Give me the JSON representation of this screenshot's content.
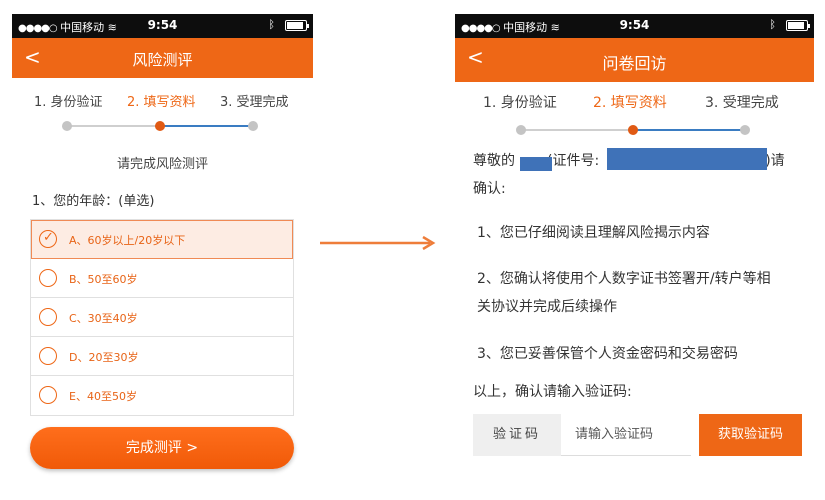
{
  "status_bar": {
    "signal_dots": "●●●●○",
    "carrier": "中国移动",
    "wifi_icon": "wifi-icon",
    "time": "9:54",
    "bluetooth_icon": "bluetooth-icon",
    "battery_icon": "battery-icon"
  },
  "left": {
    "nav": {
      "back": "<",
      "title": "风险测评"
    },
    "steps": [
      "1. 身份验证",
      "2. 填写资料",
      "3. 受理完成"
    ],
    "active_step": 2,
    "prompt": "请完成风险测评",
    "question": "1、您的年龄：(单选)",
    "options": [
      {
        "text": "A、60岁以上/20岁以下",
        "selected": true
      },
      {
        "text": "B、50至60岁",
        "selected": false
      },
      {
        "text": "C、30至40岁",
        "selected": false
      },
      {
        "text": "D、20至30岁",
        "selected": false
      },
      {
        "text": "E、40至50岁",
        "selected": false
      }
    ],
    "finish_button": "完成测评 >"
  },
  "right": {
    "nav": {
      "back": "<",
      "title": "问卷回访"
    },
    "steps": [
      "1. 身份验证",
      "2. 填写资料",
      "3. 受理完成"
    ],
    "active_step": 2,
    "greeting_prefix": "尊敬的",
    "greeting_mid": "(证件号:",
    "greeting_suffix": ")请",
    "greeting_line2": "确认:",
    "item1": "1、您已仔细阅读且理解风险揭示内容",
    "item2_line1": "2、您确认将使用个人数字证书签署开/转户等相",
    "item2_line2": "关协议并完成后续操作",
    "item3": "3、您已妥善保管个人资金密码和交易密码",
    "instruction": "以上，确认请输入验证码:",
    "verify_label": "验证码",
    "verify_placeholder": "请输入验证码",
    "get_code_button": "获取验证码"
  },
  "colors": {
    "accent": "#ee6716",
    "status_bar": "#0d0d0d",
    "redaction": "#3f72b8",
    "selected_bg": "#fdece3"
  }
}
